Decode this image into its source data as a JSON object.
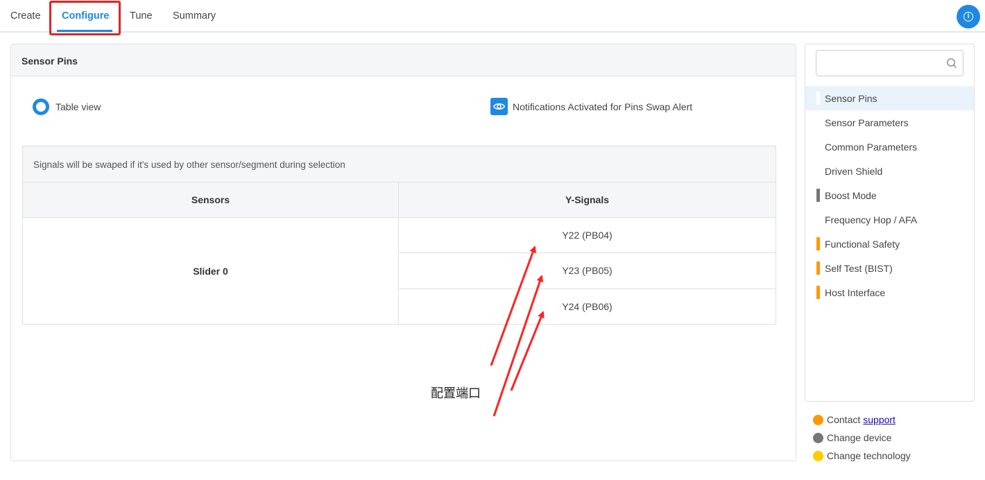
{
  "tabs": [
    {
      "label": "Create",
      "active": false
    },
    {
      "label": "Configure",
      "active": true
    },
    {
      "label": "Tune",
      "active": false
    },
    {
      "label": "Summary",
      "active": false
    }
  ],
  "info_icon": "info-icon",
  "panel": {
    "title": "Sensor Pins",
    "view_option": "Table view",
    "notification": "Notifications Activated for Pins Swap Alert",
    "table": {
      "note": "Signals will be swaped if it's used by other sensor/segment during selection",
      "headers": [
        "Sensors",
        "Y-Signals"
      ],
      "sensor": "Slider 0",
      "signals": [
        "Y22 (PB04)",
        "Y23 (PB05)",
        "Y24 (PB06)"
      ]
    }
  },
  "annotation": {
    "text": "配置端口",
    "color": "#ff2222"
  },
  "sidebar": {
    "search_placeholder": "",
    "items": [
      {
        "label": "Sensor Pins",
        "marker": "#ffffff",
        "active": true
      },
      {
        "label": "Sensor Parameters",
        "marker": null,
        "active": false
      },
      {
        "label": "Common Parameters",
        "marker": null,
        "active": false
      },
      {
        "label": "Driven Shield",
        "marker": null,
        "active": false
      },
      {
        "label": "Boost Mode",
        "marker": "#777777",
        "active": false
      },
      {
        "label": "Frequency Hop / AFA",
        "marker": null,
        "active": false
      },
      {
        "label": "Functional Safety",
        "marker": "#ff9800",
        "active": false
      },
      {
        "label": "Self Test (BIST)",
        "marker": "#ff9800",
        "active": false
      },
      {
        "label": "Host Interface",
        "marker": "#ff9800",
        "active": false
      }
    ]
  },
  "footer": {
    "contact_label": "Contact",
    "contact_link": "support",
    "change_device": "Change device",
    "change_technology": "Change technology",
    "colors": {
      "contact": "#ff9800",
      "device": "#777777",
      "technology": "#ffcc00"
    }
  },
  "colors": {
    "accent": "#1e88e5",
    "highlight_box": "#e02424"
  }
}
